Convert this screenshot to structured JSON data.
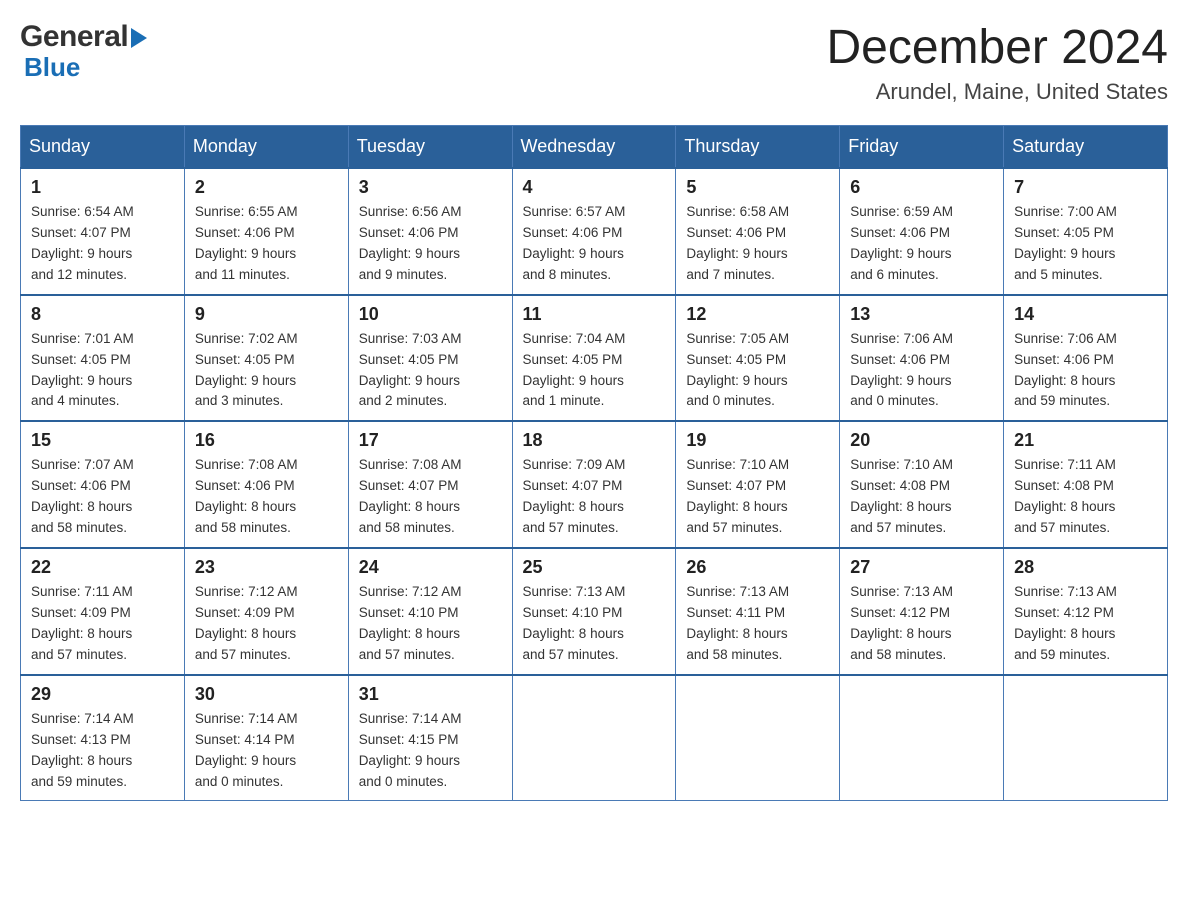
{
  "header": {
    "month_title": "December 2024",
    "location": "Arundel, Maine, United States",
    "logo_general": "General",
    "logo_blue": "Blue"
  },
  "days_of_week": [
    "Sunday",
    "Monday",
    "Tuesday",
    "Wednesday",
    "Thursday",
    "Friday",
    "Saturday"
  ],
  "weeks": [
    [
      {
        "day": "1",
        "sunrise": "6:54 AM",
        "sunset": "4:07 PM",
        "daylight": "9 hours and 12 minutes."
      },
      {
        "day": "2",
        "sunrise": "6:55 AM",
        "sunset": "4:06 PM",
        "daylight": "9 hours and 11 minutes."
      },
      {
        "day": "3",
        "sunrise": "6:56 AM",
        "sunset": "4:06 PM",
        "daylight": "9 hours and 9 minutes."
      },
      {
        "day": "4",
        "sunrise": "6:57 AM",
        "sunset": "4:06 PM",
        "daylight": "9 hours and 8 minutes."
      },
      {
        "day": "5",
        "sunrise": "6:58 AM",
        "sunset": "4:06 PM",
        "daylight": "9 hours and 7 minutes."
      },
      {
        "day": "6",
        "sunrise": "6:59 AM",
        "sunset": "4:06 PM",
        "daylight": "9 hours and 6 minutes."
      },
      {
        "day": "7",
        "sunrise": "7:00 AM",
        "sunset": "4:05 PM",
        "daylight": "9 hours and 5 minutes."
      }
    ],
    [
      {
        "day": "8",
        "sunrise": "7:01 AM",
        "sunset": "4:05 PM",
        "daylight": "9 hours and 4 minutes."
      },
      {
        "day": "9",
        "sunrise": "7:02 AM",
        "sunset": "4:05 PM",
        "daylight": "9 hours and 3 minutes."
      },
      {
        "day": "10",
        "sunrise": "7:03 AM",
        "sunset": "4:05 PM",
        "daylight": "9 hours and 2 minutes."
      },
      {
        "day": "11",
        "sunrise": "7:04 AM",
        "sunset": "4:05 PM",
        "daylight": "9 hours and 1 minute."
      },
      {
        "day": "12",
        "sunrise": "7:05 AM",
        "sunset": "4:05 PM",
        "daylight": "9 hours and 0 minutes."
      },
      {
        "day": "13",
        "sunrise": "7:06 AM",
        "sunset": "4:06 PM",
        "daylight": "9 hours and 0 minutes."
      },
      {
        "day": "14",
        "sunrise": "7:06 AM",
        "sunset": "4:06 PM",
        "daylight": "8 hours and 59 minutes."
      }
    ],
    [
      {
        "day": "15",
        "sunrise": "7:07 AM",
        "sunset": "4:06 PM",
        "daylight": "8 hours and 58 minutes."
      },
      {
        "day": "16",
        "sunrise": "7:08 AM",
        "sunset": "4:06 PM",
        "daylight": "8 hours and 58 minutes."
      },
      {
        "day": "17",
        "sunrise": "7:08 AM",
        "sunset": "4:07 PM",
        "daylight": "8 hours and 58 minutes."
      },
      {
        "day": "18",
        "sunrise": "7:09 AM",
        "sunset": "4:07 PM",
        "daylight": "8 hours and 57 minutes."
      },
      {
        "day": "19",
        "sunrise": "7:10 AM",
        "sunset": "4:07 PM",
        "daylight": "8 hours and 57 minutes."
      },
      {
        "day": "20",
        "sunrise": "7:10 AM",
        "sunset": "4:08 PM",
        "daylight": "8 hours and 57 minutes."
      },
      {
        "day": "21",
        "sunrise": "7:11 AM",
        "sunset": "4:08 PM",
        "daylight": "8 hours and 57 minutes."
      }
    ],
    [
      {
        "day": "22",
        "sunrise": "7:11 AM",
        "sunset": "4:09 PM",
        "daylight": "8 hours and 57 minutes."
      },
      {
        "day": "23",
        "sunrise": "7:12 AM",
        "sunset": "4:09 PM",
        "daylight": "8 hours and 57 minutes."
      },
      {
        "day": "24",
        "sunrise": "7:12 AM",
        "sunset": "4:10 PM",
        "daylight": "8 hours and 57 minutes."
      },
      {
        "day": "25",
        "sunrise": "7:13 AM",
        "sunset": "4:10 PM",
        "daylight": "8 hours and 57 minutes."
      },
      {
        "day": "26",
        "sunrise": "7:13 AM",
        "sunset": "4:11 PM",
        "daylight": "8 hours and 58 minutes."
      },
      {
        "day": "27",
        "sunrise": "7:13 AM",
        "sunset": "4:12 PM",
        "daylight": "8 hours and 58 minutes."
      },
      {
        "day": "28",
        "sunrise": "7:13 AM",
        "sunset": "4:12 PM",
        "daylight": "8 hours and 59 minutes."
      }
    ],
    [
      {
        "day": "29",
        "sunrise": "7:14 AM",
        "sunset": "4:13 PM",
        "daylight": "8 hours and 59 minutes."
      },
      {
        "day": "30",
        "sunrise": "7:14 AM",
        "sunset": "4:14 PM",
        "daylight": "9 hours and 0 minutes."
      },
      {
        "day": "31",
        "sunrise": "7:14 AM",
        "sunset": "4:15 PM",
        "daylight": "9 hours and 0 minutes."
      },
      null,
      null,
      null,
      null
    ]
  ],
  "labels": {
    "sunrise": "Sunrise:",
    "sunset": "Sunset:",
    "daylight": "Daylight:"
  }
}
